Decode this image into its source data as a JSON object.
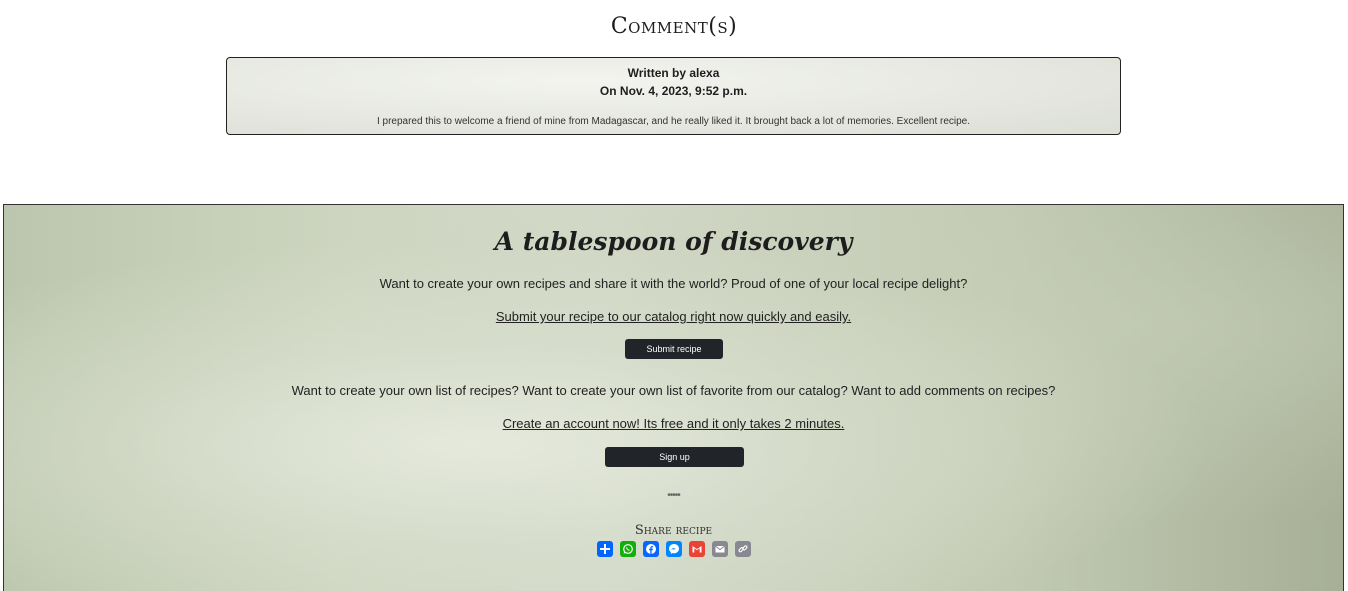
{
  "comments": {
    "title": "Comment(s)",
    "items": [
      {
        "author": "Written by alexa",
        "date": "On Nov. 4, 2023, 9:52 p.m.",
        "text": "I prepared this to welcome a friend of mine from Madagascar, and he really liked it. It brought back a lot of memories. Excellent recipe."
      }
    ]
  },
  "footer": {
    "tagline": "A tablespoon of discovery",
    "submit_prompt": "Want to create your own recipes and share it with the world? Proud of one of your local recipe delight?",
    "submit_link": "Submit your recipe to our catalog right now quickly and easily.",
    "submit_button": "Submit recipe",
    "signup_prompt": "Want to create your own list of recipes? Want to create your own list of favorite from our catalog? Want to add comments on recipes?",
    "signup_link": "Create an account now! Its free and it only takes 2 minutes.",
    "signup_button": "Sign up",
    "divider": "•••••",
    "share_label": "Share recipe",
    "share_buttons": [
      {
        "name": "share-icon",
        "color": "#0166ff"
      },
      {
        "name": "whatsapp-icon",
        "color": "#12af0a"
      },
      {
        "name": "facebook-icon",
        "color": "#0866ff"
      },
      {
        "name": "messenger-icon",
        "color": "#0084ff"
      },
      {
        "name": "gmail-icon",
        "color": "#ea4335"
      },
      {
        "name": "email-icon",
        "color": "#888990"
      },
      {
        "name": "copy-link-icon",
        "color": "#888990"
      }
    ]
  }
}
